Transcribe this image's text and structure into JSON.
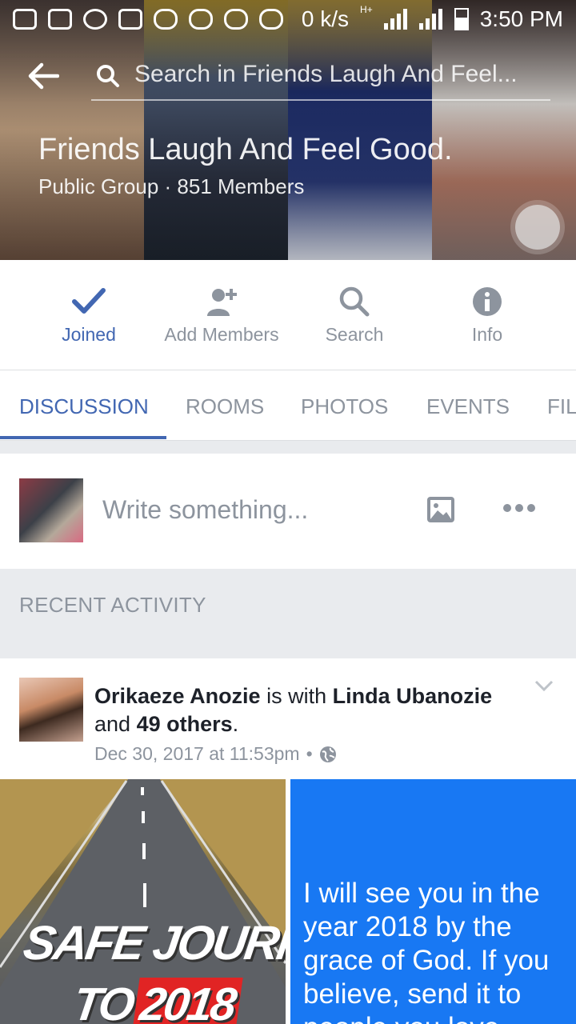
{
  "status_bar": {
    "network_speed": "0 k/s",
    "network_type": "H+",
    "time": "3:50 PM",
    "icons": [
      "chat-bubble-icon",
      "gmail-icon",
      "whatsapp-icon",
      "gallery-icon",
      "game-controller-icon",
      "game-controller-icon",
      "game-controller-icon",
      "game-controller-icon",
      "signal-icon",
      "signal-icon",
      "battery-icon"
    ]
  },
  "header": {
    "search_placeholder": "Search in Friends Laugh And Feel...",
    "group_name": "Friends Laugh And Feel Good.",
    "group_subtitle": "Public Group · 851 Members"
  },
  "actions": [
    {
      "label": "Joined",
      "icon": "checkmark-icon",
      "active": true
    },
    {
      "label": "Add Members",
      "icon": "add-person-icon",
      "active": false
    },
    {
      "label": "Search",
      "icon": "search-icon",
      "active": false
    },
    {
      "label": "Info",
      "icon": "info-icon",
      "active": false
    }
  ],
  "tabs": [
    {
      "label": "DISCUSSION",
      "active": true
    },
    {
      "label": "ROOMS",
      "active": false
    },
    {
      "label": "PHOTOS",
      "active": false
    },
    {
      "label": "EVENTS",
      "active": false
    },
    {
      "label": "FIL",
      "active": false
    }
  ],
  "composer": {
    "placeholder": "Write something..."
  },
  "section_label": "RECENT ACTIVITY",
  "post": {
    "author": "Orikaeze Anozie",
    "with_text": "is with",
    "tagged": "Linda Ubanozie",
    "and_text": "and",
    "others": "49 others",
    "end_punct": ".",
    "timestamp": "Dec 30, 2017 at 11:53pm",
    "separator": "•",
    "privacy_icon": "globe-icon",
    "image1_line1": "SAFE JOURNEY",
    "image1_to": "TO",
    "image1_year": "2018",
    "image2_text": "I will see you in the year 2018 by the grace of God. If you believe, send it to people you love"
  },
  "colors": {
    "accent": "#4267b2",
    "muted": "#8d949e",
    "divider": "#e9ebee",
    "blue_card": "#1878f3"
  }
}
